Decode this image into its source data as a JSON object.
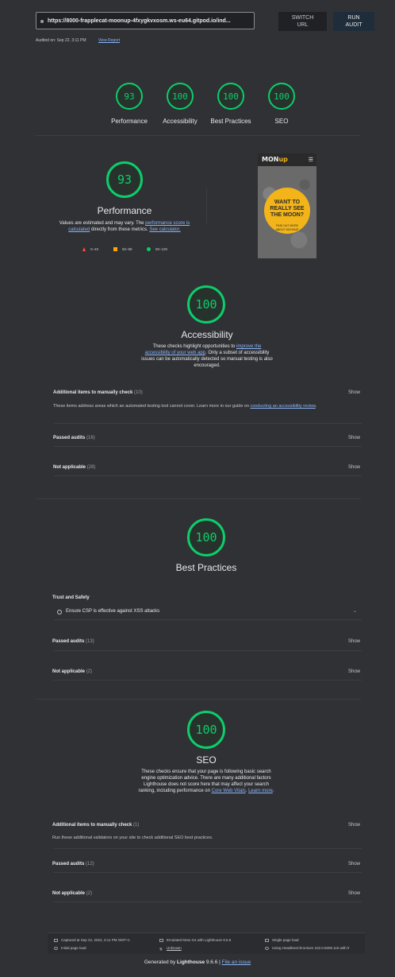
{
  "topbar": {
    "url": "https://8000-frapplecat-moonup-4fxygkvxosm.ws-eu64.gitpod.io/ind...",
    "switch_url": "SWITCH URL",
    "run_audit": "RUN AUDIT",
    "audited_on": "Audited on: Sep 22, 3:11 PM",
    "view_report": "View Report"
  },
  "summary": [
    {
      "score": "93",
      "label": "Performance"
    },
    {
      "score": "100",
      "label": "Accessibility"
    },
    {
      "score": "100",
      "label": "Best Practices"
    },
    {
      "score": "100",
      "label": "SEO"
    }
  ],
  "performance": {
    "score": "93",
    "title": "Performance",
    "text_a": "Values are estimated and may vary. The ",
    "link_a": "performance score is calculated",
    "text_b": " directly from these metrics. ",
    "link_b": "See calculator.",
    "legend": [
      "0–49",
      "50–89",
      "90–100"
    ],
    "screenshot": {
      "logo_a": "M",
      "logo_b": "ON",
      "logo_c": "up",
      "headline": "WANT TO REALLY SEE THE MOON?",
      "sub": "FIND OUT MORE ABOUT MOONUP"
    }
  },
  "accessibility": {
    "score": "100",
    "title": "Accessibility",
    "text_a": "These checks highlight opportunities to ",
    "link_a": "improve the accessibility of your web app",
    "text_b": ". Only a subset of accessibility issues can be automatically detected so manual testing is also encouraged.",
    "manual_title": "Additional items to manually check",
    "manual_count": "(10)",
    "manual_desc": "These items address areas which an automated testing tool cannot cover. Learn more in our guide on ",
    "manual_link": "conducting an accessibility review",
    "manual_desc_end": ".",
    "passed_title": "Passed audits",
    "passed_count": "(16)",
    "na_title": "Not applicable",
    "na_count": "(28)",
    "show": "Show"
  },
  "best_practices": {
    "score": "100",
    "title": "Best Practices",
    "group_title": "Trust and Safety",
    "item": "Ensure CSP is effective against XSS attacks",
    "passed_title": "Passed audits",
    "passed_count": "(13)",
    "na_title": "Not applicable",
    "na_count": "(2)",
    "show": "Show"
  },
  "seo": {
    "score": "100",
    "title": "SEO",
    "text_a": "These checks ensure that your page is following basic search engine optimization advice. There are many additional factors Lighthouse does not score here that may affect your search ranking, including performance on ",
    "link_a": "Core Web Vitals",
    "text_b": ". ",
    "link_b": "Learn more",
    "text_c": ".",
    "manual_title": "Additional items to manually check",
    "manual_count": "(1)",
    "manual_desc": "Run these additional validators on your site to check additional SEO best practices.",
    "passed_title": "Passed audits",
    "passed_count": "(12)",
    "na_title": "Not applicable",
    "na_count": "(2)",
    "show": "Show"
  },
  "footer": {
    "captured": "Captured at Sep 22, 2022, 3:11 PM GMT+1",
    "initial": "Initial page load",
    "emulated": "Emulated Moto G4 with Lighthouse 9.6.6",
    "unknown": "Unknown",
    "single": "Single page load",
    "using": "Using HeadlessChromium 102.0.5005.115 with lr",
    "generated_a": "Generated by ",
    "generated_b": "Lighthouse",
    "generated_c": " 9.6.6 | ",
    "file_issue": "File an issue"
  },
  "colors": {
    "pass": "#0cce6b",
    "average": "#ffa400",
    "fail": "#ff4e42",
    "link": "#8ab4f8"
  }
}
